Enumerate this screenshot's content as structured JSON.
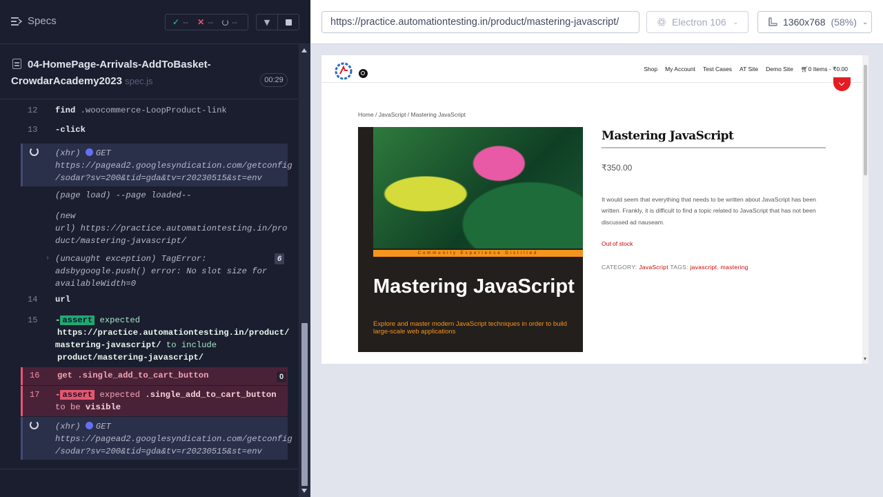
{
  "runner": {
    "specs_label": "Specs",
    "stats": {
      "passed": "--",
      "failed": "--",
      "pending": "--"
    },
    "spec": {
      "name_line1": "04-HomePage-Arrivals-AddToBasket-",
      "name_line2": "CrowdarAcademy2023",
      "ext": "spec.js",
      "duration": "00:29"
    },
    "log": {
      "r12": {
        "num": "12",
        "cmd": "find",
        "sel": ".woocommerce-LoopProduct-link"
      },
      "r13": {
        "num": "13",
        "cmd": "-click"
      },
      "xhr1": {
        "label": "(xhr)",
        "method": "GET",
        "url1": "https://pagead2.googlesyndication.com/getconfig",
        "url2": "/sodar?sv=200&tid=gda&tv=r20230515&st=env"
      },
      "pageload": {
        "label": "(page load)",
        "msg": "--page loaded--"
      },
      "newurl": {
        "label1": "(new",
        "label2": "url)",
        "url1": "https://practice.automationtesting.in/pro",
        "url2": "duct/mastering-javascript/"
      },
      "uncaught": {
        "label": "(uncaught exception)",
        "msg1": "TagError:",
        "msg2": "adsbygoogle.push() error: No slot size for",
        "msg3": "availableWidth=0",
        "count": "6"
      },
      "r14": {
        "num": "14",
        "cmd": "url"
      },
      "r15": {
        "num": "15",
        "assert": "assert",
        "expected": "expected",
        "line2": "https://practice.automationtesting.in/product/",
        "line3a": "mastering-javascript/",
        "line3b": "to include",
        "line4": "product/mastering-javascript/"
      },
      "r16": {
        "num": "16",
        "cmd": "get",
        "sel": ".single_add_to_cart_button",
        "count": "0"
      },
      "r17": {
        "num": "17",
        "assert": "assert",
        "expected": "expected",
        "sel": ".single_add_to_cart_button",
        "tobe": "to be",
        "visible": "visible"
      },
      "xhr2": {
        "label": "(xhr)",
        "method": "GET",
        "url1": "https://pagead2.googlesyndication.com/getconfig",
        "url2": "/sodar?sv=200&tid=gda&tv=r20230515&st=env"
      }
    }
  },
  "aut_header": {
    "url": "https://practice.automationtesting.in/product/mastering-javascript/",
    "browser": "Electron 106",
    "viewport": "1360x768",
    "scale": "(58%)"
  },
  "site": {
    "menu": [
      "Shop",
      "My Account",
      "Test Cases",
      "AT Site",
      "Demo Site"
    ],
    "cart": "0 Items - ₹0.00",
    "breadcrumb": "Home / JavaScript / Mastering JavaScript",
    "book": {
      "tagline": "Community Experience Distilled",
      "title": "Mastering JavaScript",
      "subtitle": "Explore and master modern JavaScript techniques in order to build large-scale web applications"
    },
    "product": {
      "title": "Mastering JavaScript",
      "price": "₹350.00",
      "description": "It would seem that everything that needs to be written about JavaScript has been written. Frankly, it is difficult to find a topic related to JavaScript that has not been discussed ad nauseam.",
      "stock": "Out of stock",
      "category_label": "CATEGORY:",
      "category": "JavaScript",
      "tags_label": "TAGS:",
      "tag1": "javascript",
      "tag2": "mastering"
    }
  },
  "colors": {
    "runner_bg": "#1b1e2e",
    "pass": "#1fa971",
    "fail": "#e45770",
    "xhr_dot": "#6470f3",
    "site_accent": "#cc0000"
  }
}
